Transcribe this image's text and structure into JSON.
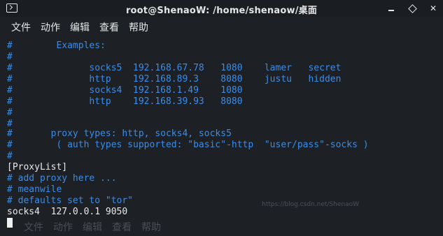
{
  "window": {
    "title": "root@ShenaoW: /home/shenaow/桌面",
    "terminal_icon": "terminal-icon",
    "controls": [
      "minimize-icon",
      "maximize-icon",
      "close-icon"
    ]
  },
  "menu": {
    "items": [
      "文件",
      "动作",
      "编辑",
      "查看",
      "帮助"
    ]
  },
  "terminal": {
    "lines": [
      {
        "text": "#        Examples:",
        "color": "blue"
      },
      {
        "text": "#",
        "color": "blue"
      },
      {
        "text": "#              socks5  192.168.67.78   1080    lamer   secret",
        "color": "blue"
      },
      {
        "text": "#              http    192.168.89.3    8080    justu   hidden",
        "color": "blue"
      },
      {
        "text": "#              socks4  192.168.1.49    1080",
        "color": "blue"
      },
      {
        "text": "#              http    192.168.39.93   8080",
        "color": "blue"
      },
      {
        "text": "#",
        "color": "blue"
      },
      {
        "text": "#",
        "color": "blue"
      },
      {
        "text": "#       proxy types: http, socks4, socks5",
        "color": "blue"
      },
      {
        "text": "#        ( auth types supported: \"basic\"-http  \"user/pass\"-socks )",
        "color": "blue"
      },
      {
        "text": "#",
        "color": "blue"
      },
      {
        "text": "[ProxyList]",
        "color": "white"
      },
      {
        "text": "# add proxy here ...",
        "color": "blue"
      },
      {
        "text": "# meanwile",
        "color": "blue"
      },
      {
        "text": "# defaults set to \"tor\"",
        "color": "blue"
      },
      {
        "text": "socks4  127.0.0.1 9050",
        "color": "white"
      }
    ],
    "ghost_menu": [
      "文件",
      "动作",
      "编辑",
      "查看",
      "帮助"
    ],
    "watermark": "https://blog.csdn.net/ShenaoW"
  },
  "colors": {
    "background": "#1d2126",
    "comment_blue": "#3c8ce6",
    "text_white": "#e8e8e8"
  }
}
